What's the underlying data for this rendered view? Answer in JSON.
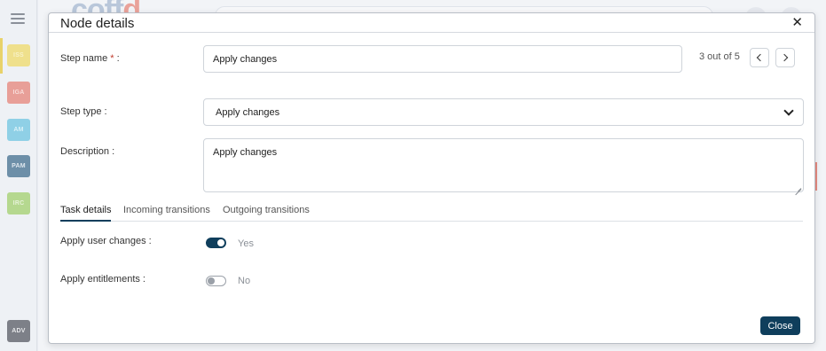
{
  "background": {
    "rail_tiles": [
      {
        "label": "ISS",
        "color": "#efe08c"
      },
      {
        "label": "IGA",
        "color": "#e89f98"
      },
      {
        "label": "AM",
        "color": "#8fd0e6"
      },
      {
        "label": "PAM",
        "color": "#6d8fa8"
      },
      {
        "label": "IRC",
        "color": "#b5d88f"
      },
      {
        "label": "ADV",
        "color": "#7d8088"
      }
    ],
    "logo_text": "coff",
    "logo_suffix": "d"
  },
  "modal": {
    "title": "Node details",
    "close_icon": "✕",
    "step_name": {
      "label": "Step name",
      "required_mark": "*",
      "suffix": " :",
      "value": "Apply changes"
    },
    "pager": {
      "text": "3 out of 5"
    },
    "step_type": {
      "label": "Step type :",
      "value": "Apply changes"
    },
    "description": {
      "label": "Description :",
      "value": "Apply changes"
    },
    "tabs": [
      {
        "label": "Task details",
        "active": true
      },
      {
        "label": "Incoming transitions",
        "active": false
      },
      {
        "label": "Outgoing transitions",
        "active": false
      }
    ],
    "apply_user_changes": {
      "label": "Apply user changes :",
      "state_text": "Yes",
      "on": true
    },
    "apply_entitlements": {
      "label": "Apply entitlements :",
      "state_text": "No",
      "on": false
    },
    "close_button": "Close"
  },
  "colors": {
    "primary": "#0f3e5c",
    "required": "#c0392b"
  }
}
